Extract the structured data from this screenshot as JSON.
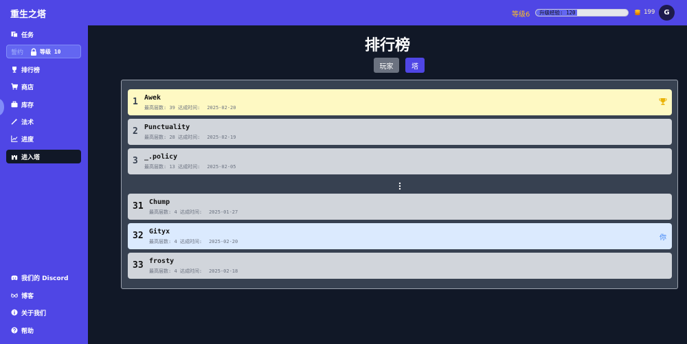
{
  "app": {
    "title": "重生之塔"
  },
  "topbar": {
    "level_label": "等级6",
    "xp_label": "升级经验: 120",
    "xp_fraction": 0.45,
    "coins": "199",
    "avatar_initial": "G"
  },
  "sidebar": {
    "items": [
      {
        "label": "任务",
        "icon": "tasks-icon"
      },
      {
        "label": "排行榜",
        "icon": "trophy-icon"
      },
      {
        "label": "商店",
        "icon": "cart-icon"
      },
      {
        "label": "库存",
        "icon": "briefcase-icon"
      },
      {
        "label": "法术",
        "icon": "wand-icon"
      },
      {
        "label": "进度",
        "icon": "chart-line-icon"
      },
      {
        "label": "进入塔",
        "icon": "tower-icon"
      }
    ],
    "locked": {
      "label": "誓约",
      "level": "等级 10"
    },
    "footer": [
      {
        "label": "我们的 Discord",
        "icon": "discord-icon"
      },
      {
        "label": "博客",
        "icon": "glasses-icon"
      },
      {
        "label": "关于我们",
        "icon": "info-icon"
      },
      {
        "label": "帮助",
        "icon": "help-icon"
      }
    ]
  },
  "main": {
    "title": "排行榜",
    "tabs": [
      {
        "label": "玩家",
        "active": false
      },
      {
        "label": "塔",
        "active": true
      }
    ],
    "meta_floor_label": "最高层数:",
    "meta_date_label": "达成时间:",
    "you_label": "你",
    "rows": [
      {
        "rank": "1",
        "name": "Awek",
        "floor": "39",
        "date": "2025-02-20"
      },
      {
        "rank": "2",
        "name": "Punctuality",
        "floor": "28",
        "date": "2025-02-19"
      },
      {
        "rank": "3",
        "name": "_.policy",
        "floor": "13",
        "date": "2025-02-05"
      },
      {
        "rank": "31",
        "name": "Chump",
        "floor": "4",
        "date": "2025-01-27"
      },
      {
        "rank": "32",
        "name": "Gityx",
        "floor": "4",
        "date": "2025-02-20"
      },
      {
        "rank": "33",
        "name": "frosty",
        "floor": "4",
        "date": "2025-02-18"
      }
    ]
  },
  "colors": {
    "brand": "#4f46e5",
    "background": "#111827",
    "first_place": "#fef9c3",
    "current_player": "#dbeafe",
    "gold": "#eab308"
  }
}
